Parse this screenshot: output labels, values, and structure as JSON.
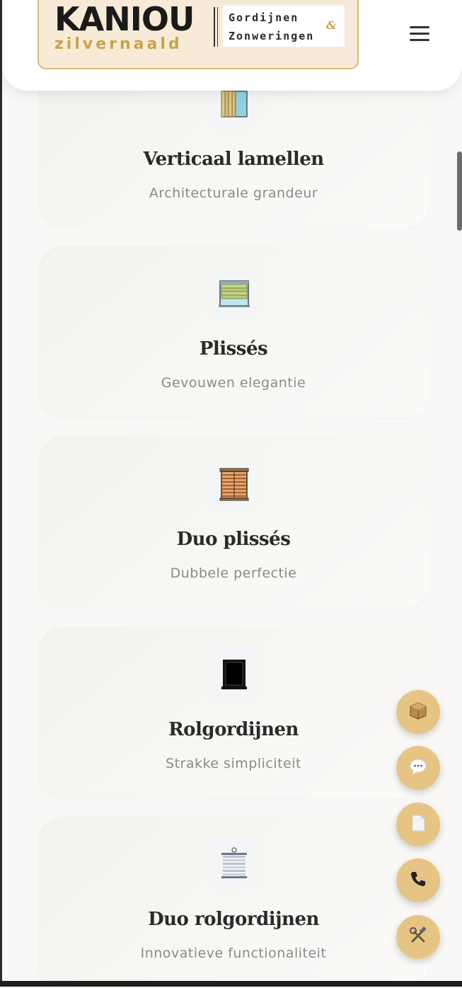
{
  "header": {
    "logo": {
      "brand": "KANIOU",
      "sub": "zilvernaald",
      "line1": "Gordijnen",
      "amp": "&",
      "line2": "Zonweringen"
    }
  },
  "products": [
    {
      "title": "Verticaal lamellen",
      "subtitle": "Architecturale grandeur",
      "icon": "vertical-blinds-icon"
    },
    {
      "title": "Plissés",
      "subtitle": "Gevouwen elegantie",
      "icon": "pleated-blinds-icon"
    },
    {
      "title": "Duo plissés",
      "subtitle": "Dubbele perfectie",
      "icon": "duo-pleated-icon"
    },
    {
      "title": "Rolgordijnen",
      "subtitle": "Strakke simpliciteit",
      "icon": "roller-blind-icon"
    },
    {
      "title": "Duo rolgordijnen",
      "subtitle": "Innovatieve functionaliteit",
      "icon": "duo-roller-icon"
    }
  ],
  "fabs": [
    {
      "icon": "package-icon"
    },
    {
      "icon": "chat-bubble-icon"
    },
    {
      "icon": "document-icon"
    },
    {
      "icon": "phone-icon"
    },
    {
      "icon": "tools-icon"
    }
  ],
  "colors": {
    "accent": "#e6c584",
    "logo_gold": "#c9a24a",
    "background": "#f9f8f6"
  }
}
